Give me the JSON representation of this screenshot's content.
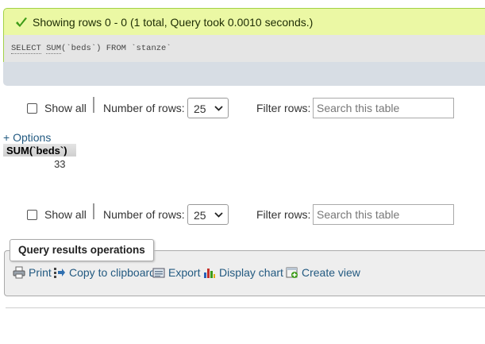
{
  "status": {
    "message": "Showing rows 0 -  0 (1 total, Query took 0.0010 seconds.)",
    "color": "#ebf8a4"
  },
  "query": {
    "select_kw": "SELECT",
    "sum_kw": "SUM",
    "rest": "(`beds`) FROM `stanze`"
  },
  "nav_top": {
    "show_all": "Show all",
    "num_rows_label": "Number of rows:",
    "num_rows_value": "25",
    "filter_label": "Filter rows:",
    "search_placeholder": "Search this table"
  },
  "nav_bottom": {
    "show_all": "Show all",
    "num_rows_label": "Number of rows:",
    "num_rows_value": "25",
    "filter_label": "Filter rows:",
    "search_placeholder": "Search this table"
  },
  "options_link": "+ Options",
  "results": {
    "columns": [
      "SUM(`beds`)"
    ],
    "rows": [
      [
        "33"
      ]
    ]
  },
  "operations": {
    "legend": "Query results operations",
    "print": "Print",
    "copy": "Copy to clipboard",
    "export": "Export",
    "display_chart": "Display chart",
    "create_view": "Create view"
  },
  "colors": {
    "link": "#235a81",
    "success_border": "#a2d246",
    "sql_footer": "#d7dde4"
  }
}
